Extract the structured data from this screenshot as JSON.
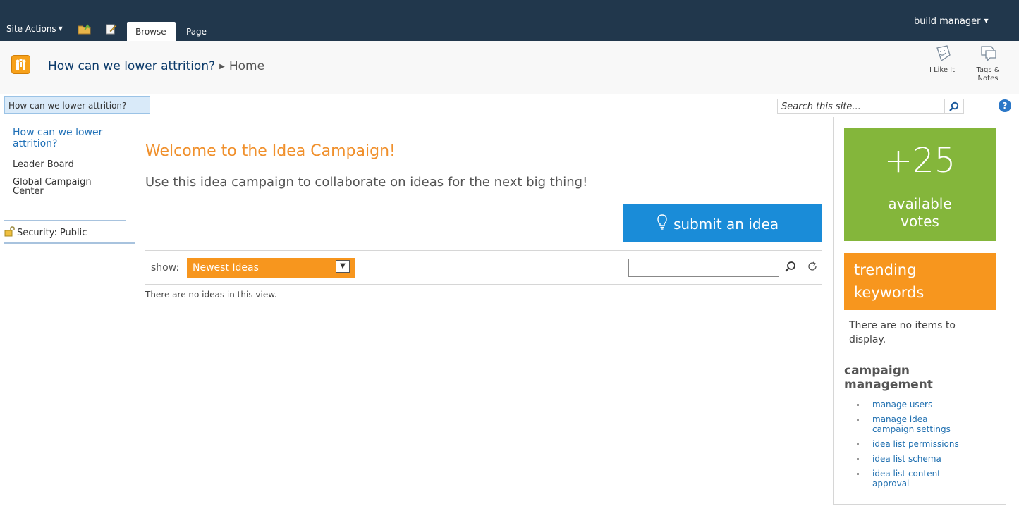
{
  "ribbon": {
    "site_actions": "Site Actions",
    "tabs": [
      "Browse",
      "Page"
    ],
    "user": "build manager"
  },
  "title_bar": {
    "site_title": "How can we lower attrition?",
    "page": "Home",
    "actions": [
      {
        "label": "I Like It",
        "icon": "i-like-it-icon"
      },
      {
        "label": "Tags & Notes",
        "icon": "tags-notes-icon"
      }
    ]
  },
  "top_nav": {
    "active_tab": "How can we lower attrition?",
    "search_placeholder": "Search this site..."
  },
  "quick_launch": {
    "items": [
      "How can we lower attrition?",
      "Leader Board",
      "Global Campaign Center"
    ],
    "security": "Security: Public"
  },
  "main": {
    "heading": "Welcome to the Idea Campaign!",
    "intro": "Use this idea campaign to collaborate on ideas for the next big thing!",
    "submit_label": "submit an idea",
    "show_label": "show:",
    "show_value": "Newest Ideas",
    "empty_message": "There are no ideas in this view."
  },
  "sidebar": {
    "votes_count": "+25",
    "votes_label": "available votes",
    "trending_title": "trending keywords",
    "trending_empty": "There are no items to display.",
    "management_title": "campaign management",
    "management_links": [
      "manage users",
      "manage idea campaign settings",
      "idea list permissions",
      "idea list schema",
      "idea list content approval"
    ]
  },
  "colors": {
    "ribbon_bg": "#21374c",
    "accent_orange": "#f7961e",
    "submit_blue": "#1a8cd8",
    "votes_green": "#84b63b",
    "link_blue": "#1f70b7"
  }
}
